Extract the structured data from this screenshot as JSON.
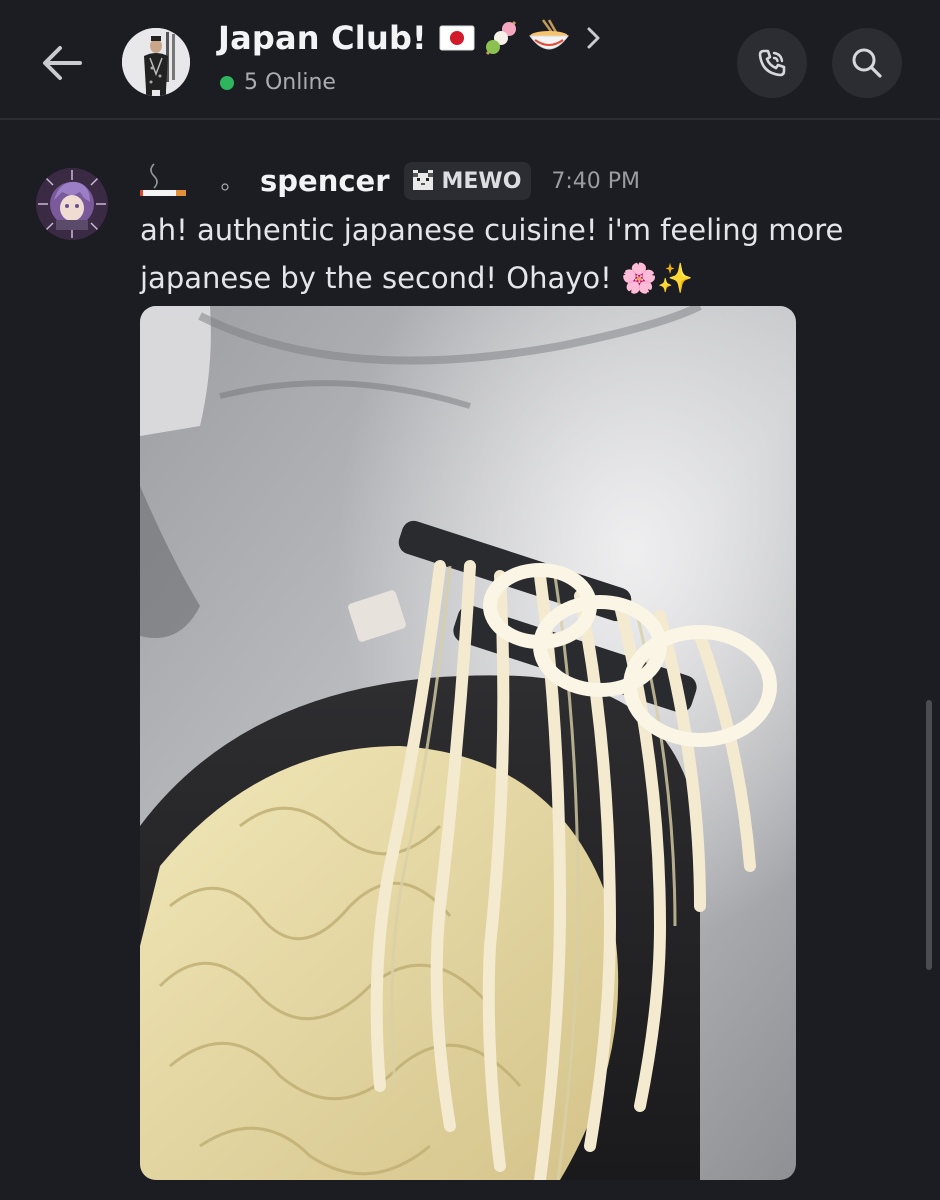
{
  "header": {
    "back_icon": "arrow-left-icon",
    "title": "Japan Club!",
    "title_emojis": [
      "japan-flag-icon",
      "dango-icon",
      "ramen-bowl-icon"
    ],
    "chevron_icon": "chevron-right-icon",
    "online_text": "5 Online",
    "online_color": "#2fb55d",
    "call_icon": "phone-call-icon",
    "search_icon": "search-icon"
  },
  "message": {
    "username": "spencer",
    "tag_label": "MEWO",
    "tag_icon": "cat-pixel-icon",
    "time": "7:40 PM",
    "decoration_icon": "cigarette-icon",
    "text": "ah! authentic japanese cuisine! i'm feeling more japanese by the second! Ohayo! 🌸✨",
    "attachment": "noodles-chopsticks-photo"
  },
  "colors": {
    "background": "#1c1d22",
    "button_bg": "#2b2d33",
    "text": "#e3e5e8"
  }
}
